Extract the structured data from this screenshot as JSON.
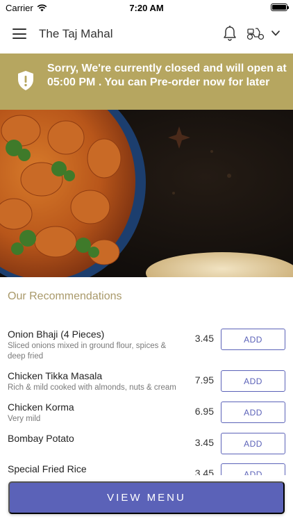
{
  "status_bar": {
    "carrier": "Carrier",
    "time": "7:20 AM",
    "battery_level": 1.0
  },
  "header": {
    "title": "The Taj Mahal",
    "icons": [
      "menu-icon",
      "bell-icon",
      "scooter-icon",
      "chevron-down-icon"
    ]
  },
  "notice": {
    "text": "Sorry, We're currently closed and will open at 05:00 PM . You can Pre-order now for later",
    "icon": "shield-alert-icon"
  },
  "section": {
    "title": "Our Recommendations"
  },
  "menu_items": [
    {
      "name": "Onion Bhaji (4 Pieces)",
      "description": "Sliced onions mixed in ground flour, spices & deep fried",
      "price": "3.45",
      "button": "ADD"
    },
    {
      "name": "Chicken Tikka Masala",
      "description": "Rich & mild cooked with almonds, nuts & cream",
      "price": "7.95",
      "button": "ADD"
    },
    {
      "name": "Chicken Korma",
      "description": "Very mild",
      "price": "6.95",
      "button": "ADD"
    },
    {
      "name": "Bombay Potato",
      "description": "",
      "price": "3.45",
      "button": "ADD"
    },
    {
      "name": "Special Fried Rice",
      "description": "",
      "price": "3.45",
      "button": "ADD"
    }
  ],
  "footer": {
    "button": "VIEW MENU"
  },
  "colors": {
    "banner": "#b6a660",
    "accent": "#5b62b8",
    "section_title": "#a9996a"
  }
}
